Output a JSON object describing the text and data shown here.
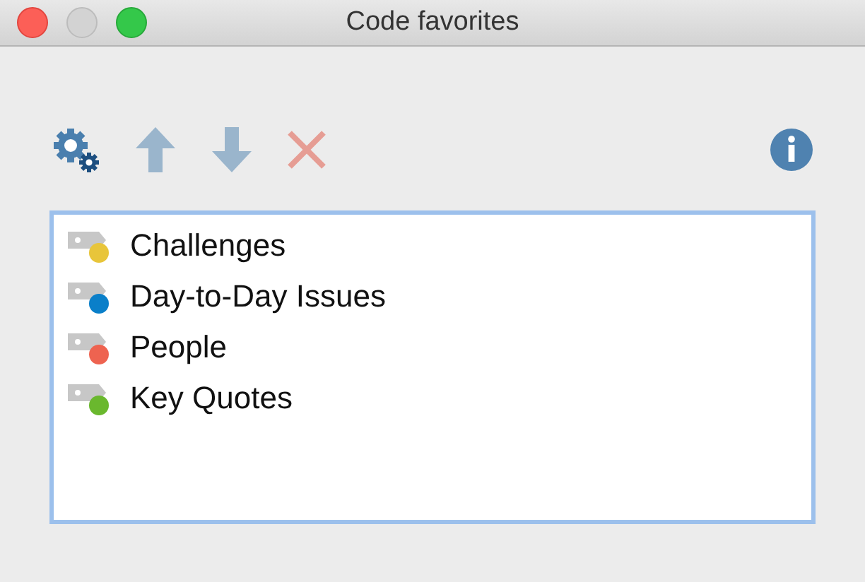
{
  "window": {
    "title": "Code favorites"
  },
  "toolbar": [
    {
      "kind": "settings",
      "disabled": false
    },
    {
      "kind": "up",
      "disabled": true
    },
    {
      "kind": "down",
      "disabled": true
    },
    {
      "kind": "delete",
      "disabled": true
    }
  ],
  "codes": [
    {
      "name": "Challenges",
      "color": "#e8c53a"
    },
    {
      "name": "Day-to-Day Issues",
      "color": "#0a7fc9"
    },
    {
      "name": "People",
      "color": "#ee6350"
    },
    {
      "name": "Key Quotes",
      "color": "#6ab82e"
    }
  ]
}
